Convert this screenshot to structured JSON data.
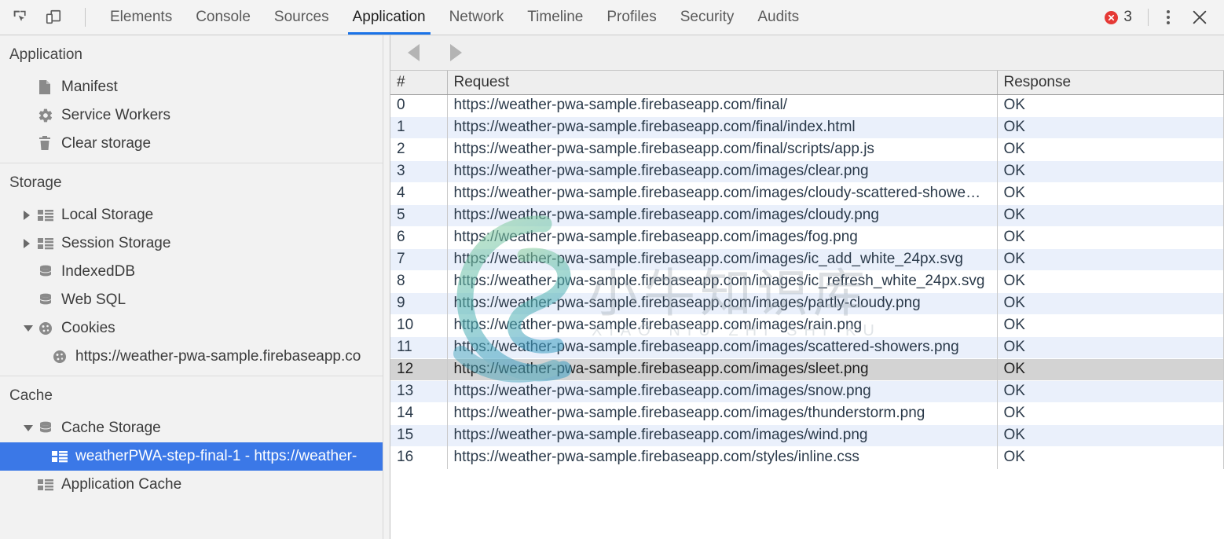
{
  "toolbar": {
    "inspect_icon": "inspect-element-icon",
    "device_icon": "device-toolbar-icon",
    "tabs": [
      {
        "label": "Elements",
        "active": false
      },
      {
        "label": "Console",
        "active": false
      },
      {
        "label": "Sources",
        "active": false
      },
      {
        "label": "Application",
        "active": true
      },
      {
        "label": "Network",
        "active": false
      },
      {
        "label": "Timeline",
        "active": false
      },
      {
        "label": "Profiles",
        "active": false
      },
      {
        "label": "Security",
        "active": false
      },
      {
        "label": "Audits",
        "active": false
      }
    ],
    "error_count": "3",
    "error_icon": "error-circle-icon",
    "menu_icon": "more-options-icon",
    "close_icon": "close-icon",
    "accent_color": "#1a73e8",
    "error_color": "#e53935"
  },
  "sidebar": {
    "sections": [
      {
        "title": "Application",
        "items": [
          {
            "label": "Manifest",
            "icon": "manifest-document-icon",
            "indent": 1,
            "twisty": "none",
            "selected": false
          },
          {
            "label": "Service Workers",
            "icon": "gear-icon",
            "indent": 1,
            "twisty": "none",
            "selected": false
          },
          {
            "label": "Clear storage",
            "icon": "trash-icon",
            "indent": 1,
            "twisty": "none",
            "selected": false
          }
        ]
      },
      {
        "title": "Storage",
        "items": [
          {
            "label": "Local Storage",
            "icon": "table-grid-icon",
            "indent": 1,
            "twisty": "collapsed",
            "selected": false
          },
          {
            "label": "Session Storage",
            "icon": "table-grid-icon",
            "indent": 1,
            "twisty": "collapsed",
            "selected": false
          },
          {
            "label": "IndexedDB",
            "icon": "database-icon",
            "indent": 1,
            "twisty": "none",
            "selected": false
          },
          {
            "label": "Web SQL",
            "icon": "database-icon",
            "indent": 1,
            "twisty": "none",
            "selected": false
          },
          {
            "label": "Cookies",
            "icon": "cookie-icon",
            "indent": 1,
            "twisty": "expanded",
            "selected": false
          },
          {
            "label": "https://weather-pwa-sample.firebaseapp.co",
            "icon": "cookie-icon",
            "indent": 2,
            "twisty": "none",
            "selected": false
          }
        ]
      },
      {
        "title": "Cache",
        "items": [
          {
            "label": "Cache Storage",
            "icon": "database-icon",
            "indent": 1,
            "twisty": "expanded",
            "selected": false
          },
          {
            "label": "weatherPWA-step-final-1 - https://weather-",
            "icon": "table-grid-icon",
            "indent": 2,
            "twisty": "none",
            "selected": true
          },
          {
            "label": "Application Cache",
            "icon": "table-grid-icon",
            "indent": 1,
            "twisty": "none",
            "selected": false
          }
        ]
      }
    ],
    "selection_color": "#3b78e7"
  },
  "main": {
    "prev_icon": "arrow-left-icon",
    "next_icon": "arrow-right-icon",
    "columns": [
      "#",
      "Request",
      "Response"
    ],
    "selected_row_index": 12,
    "rows": [
      {
        "num": "0",
        "request": "https://weather-pwa-sample.firebaseapp.com/final/",
        "response": "OK"
      },
      {
        "num": "1",
        "request": "https://weather-pwa-sample.firebaseapp.com/final/index.html",
        "response": "OK"
      },
      {
        "num": "2",
        "request": "https://weather-pwa-sample.firebaseapp.com/final/scripts/app.js",
        "response": "OK"
      },
      {
        "num": "3",
        "request": "https://weather-pwa-sample.firebaseapp.com/images/clear.png",
        "response": "OK"
      },
      {
        "num": "4",
        "request": "https://weather-pwa-sample.firebaseapp.com/images/cloudy-scattered-showe…",
        "response": "OK"
      },
      {
        "num": "5",
        "request": "https://weather-pwa-sample.firebaseapp.com/images/cloudy.png",
        "response": "OK"
      },
      {
        "num": "6",
        "request": "https://weather-pwa-sample.firebaseapp.com/images/fog.png",
        "response": "OK"
      },
      {
        "num": "7",
        "request": "https://weather-pwa-sample.firebaseapp.com/images/ic_add_white_24px.svg",
        "response": "OK"
      },
      {
        "num": "8",
        "request": "https://weather-pwa-sample.firebaseapp.com/images/ic_refresh_white_24px.svg",
        "response": "OK"
      },
      {
        "num": "9",
        "request": "https://weather-pwa-sample.firebaseapp.com/images/partly-cloudy.png",
        "response": "OK"
      },
      {
        "num": "10",
        "request": "https://weather-pwa-sample.firebaseapp.com/images/rain.png",
        "response": "OK"
      },
      {
        "num": "11",
        "request": "https://weather-pwa-sample.firebaseapp.com/images/scattered-showers.png",
        "response": "OK"
      },
      {
        "num": "12",
        "request": "https://weather-pwa-sample.firebaseapp.com/images/sleet.png",
        "response": "OK"
      },
      {
        "num": "13",
        "request": "https://weather-pwa-sample.firebaseapp.com/images/snow.png",
        "response": "OK"
      },
      {
        "num": "14",
        "request": "https://weather-pwa-sample.firebaseapp.com/images/thunderstorm.png",
        "response": "OK"
      },
      {
        "num": "15",
        "request": "https://weather-pwa-sample.firebaseapp.com/images/wind.png",
        "response": "OK"
      },
      {
        "num": "16",
        "request": "https://weather-pwa-sample.firebaseapp.com/styles/inline.css",
        "response": "OK"
      }
    ]
  },
  "watermark": {
    "text_cn": "小牛知识库",
    "text_en": "XIAO NIU ZHI SHI KU"
  }
}
